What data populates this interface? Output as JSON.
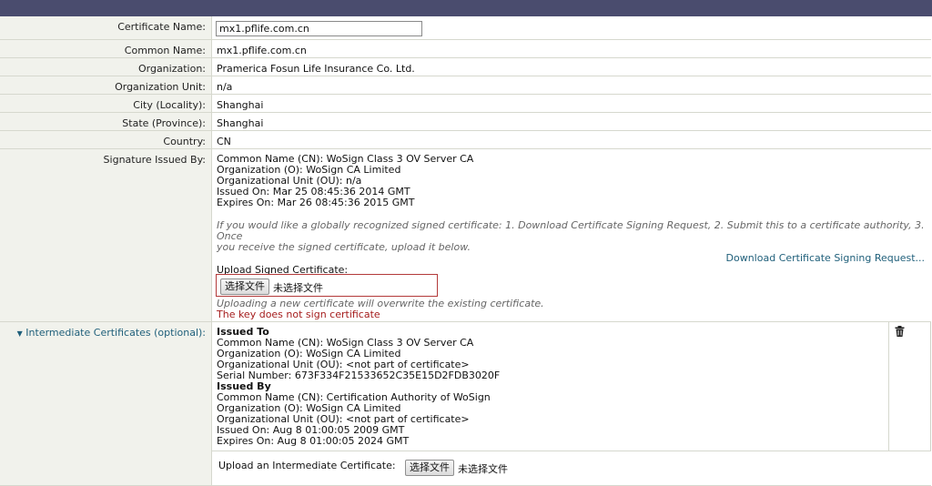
{
  "fields": {
    "certificate_name_label": "Certificate Name:",
    "certificate_name_value": "mx1.pflife.com.cn",
    "common_name_label": "Common Name:",
    "common_name_value": "mx1.pflife.com.cn",
    "organization_label": "Organization:",
    "organization_value": "Pramerica Fosun Life Insurance Co. Ltd.",
    "org_unit_label": "Organization Unit:",
    "org_unit_value": "n/a",
    "city_label": "City (Locality):",
    "city_value": "Shanghai",
    "state_label": "State (Province):",
    "state_value": "Shanghai",
    "country_label": "Country:",
    "country_value": "CN"
  },
  "signature": {
    "label": "Signature Issued By:",
    "lines": [
      "Common Name (CN): WoSign Class 3 OV Server CA",
      "Organization (O): WoSign CA Limited",
      "Organizational Unit (OU): n/a",
      "Issued On: Mar 25 08:45:36 2014 GMT",
      "Expires On: Mar 26 08:45:36 2015 GMT"
    ],
    "hint_line1": "If you would like a globally recognized signed certificate: 1. Download Certificate Signing Request, 2. Submit this to a certificate authority, 3. Once",
    "hint_line2": "you receive the signed certificate, upload it below.",
    "download_link": "Download Certificate Signing Request...",
    "upload_label": "Upload Signed Certificate:",
    "choose_button": "选择文件",
    "no_file": "未选择文件",
    "overwrite_hint": "Uploading a new certificate will overwrite the existing certificate.",
    "error": "The key does not sign certificate"
  },
  "intermediate": {
    "label": "Intermediate Certificates (optional):",
    "issued_to_heading": "Issued To",
    "issued_to_lines": [
      "Common Name (CN): WoSign Class 3 OV Server CA",
      "Organization (O): WoSign CA Limited",
      "Organizational Unit (OU): <not part of certificate>",
      "Serial Number: 673F334F21533652C35E15D2FDB3020F"
    ],
    "issued_by_heading": "Issued By",
    "issued_by_lines": [
      "Common Name (CN): Certification Authority of WoSign",
      "Organization (O): WoSign CA Limited",
      "Organizational Unit (OU): <not part of certificate>",
      "Issued On: Aug 8 01:00:05 2009 GMT",
      "Expires On: Aug 8 01:00:05 2024 GMT"
    ],
    "upload_label": "Upload an Intermediate Certificate:",
    "choose_button": "选择文件",
    "no_file": "未选择文件"
  }
}
